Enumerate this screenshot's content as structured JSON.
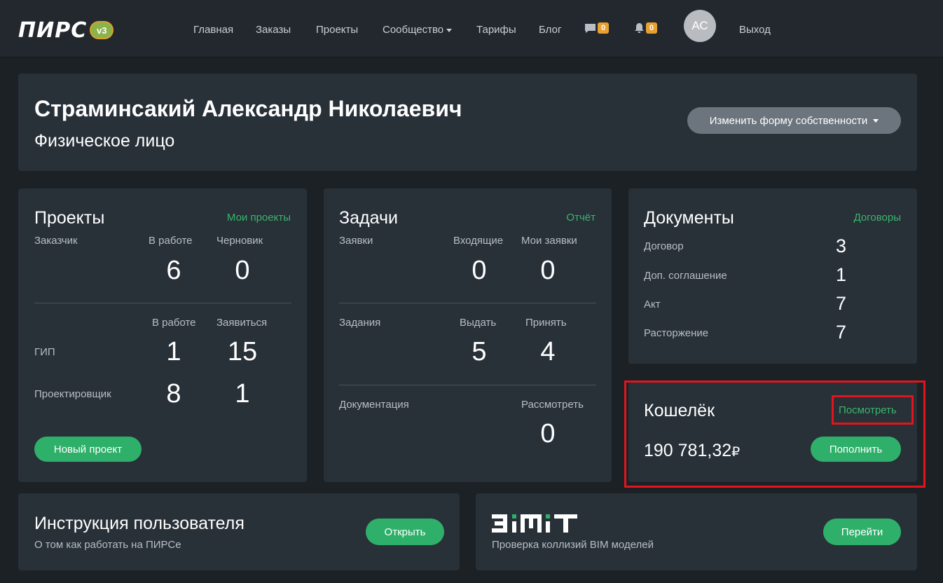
{
  "navbar": {
    "logo_text": "ПИРС",
    "logo_version": "v3",
    "links": [
      "Главная",
      "Заказы",
      "Проекты",
      "Сообщество",
      "Тарифы",
      "Блог"
    ],
    "messages_count": "0",
    "notifications_count": "0",
    "avatar_initials": "АС",
    "logout": "Выход"
  },
  "profile": {
    "name": "Страминсакий Александр Николаевич",
    "type": "Физическое лицо",
    "change_form_button": "Изменить форму собственности"
  },
  "projects": {
    "title": "Проекты",
    "link": "Мои проекты",
    "customer_label": "Заказчик",
    "col_in_work": "В работе",
    "col_draft": "Черновик",
    "customer_in_work": "6",
    "customer_draft": "0",
    "col_in_work_2": "В работе",
    "col_apply": "Заявиться",
    "gip_label": "ГИП",
    "gip_in_work": "1",
    "gip_apply": "15",
    "designer_label": "Проектировщик",
    "designer_in_work": "8",
    "designer_apply": "1",
    "new_project_button": "Новый проект"
  },
  "tasks": {
    "title": "Задачи",
    "link": "Отчёт",
    "requests_label": "Заявки",
    "col_incoming": "Входящие",
    "col_my_requests": "Мои заявки",
    "incoming": "0",
    "my_requests": "0",
    "assignments_label": "Задания",
    "col_issue": "Выдать",
    "col_accept": "Принять",
    "issue": "5",
    "accept": "4",
    "documentation_label": "Документация",
    "col_review": "Рассмотреть",
    "review": "0"
  },
  "documents": {
    "title": "Документы",
    "link": "Договоры",
    "rows": [
      {
        "label": "Договор",
        "value": "3"
      },
      {
        "label": "Доп. соглашение",
        "value": "1"
      },
      {
        "label": "Акт",
        "value": "7"
      },
      {
        "label": "Расторжение",
        "value": "7"
      }
    ]
  },
  "wallet": {
    "title": "Кошелёк",
    "link": "Посмотреть",
    "balance": "190 781,32",
    "currency": "₽",
    "topup_button": "Пополнить"
  },
  "instruction": {
    "title": "Инструкция пользователя",
    "subtitle": "О том как работать на ПИРСе",
    "button": "Открыть"
  },
  "bimit": {
    "logo_text": "BIMIT",
    "subtitle": "Проверка коллизий BIM моделей",
    "button": "Перейти"
  },
  "colors": {
    "accent_green": "#2fb06a",
    "link_green": "#3ab56c",
    "badge_orange": "#e8a030",
    "highlight_red": "#e3141b"
  }
}
